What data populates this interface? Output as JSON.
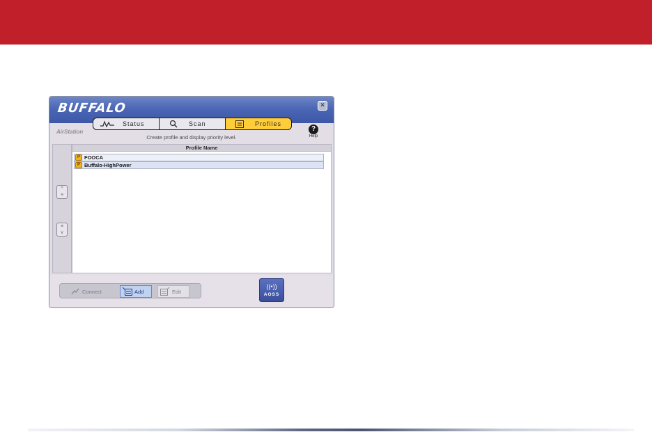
{
  "colors": {
    "banner": "#c1202a",
    "titlebar": "#4a66b5",
    "active_tab": "#ffcc3a"
  },
  "app": {
    "logo": "BUFFALO",
    "close_glyph": "×",
    "tabs": [
      {
        "label": "Status",
        "icon": "activity-icon"
      },
      {
        "label": "Scan",
        "icon": "search-icon"
      },
      {
        "label": "Profiles",
        "icon": "list-icon",
        "active": true
      }
    ],
    "brand_sub": "AirStation",
    "hint": "Create profile and display priority level.",
    "help": {
      "glyph": "?",
      "label": "Help"
    },
    "list": {
      "header": "Profile Name",
      "rows": [
        {
          "label": "FOOCA"
        },
        {
          "label": "Buffalo-HighPower"
        }
      ]
    },
    "actions": {
      "connect": "Connect",
      "add": "Add",
      "edit": "Edit"
    },
    "aoss": {
      "label": "AOSS",
      "glyph": "((•))"
    }
  }
}
